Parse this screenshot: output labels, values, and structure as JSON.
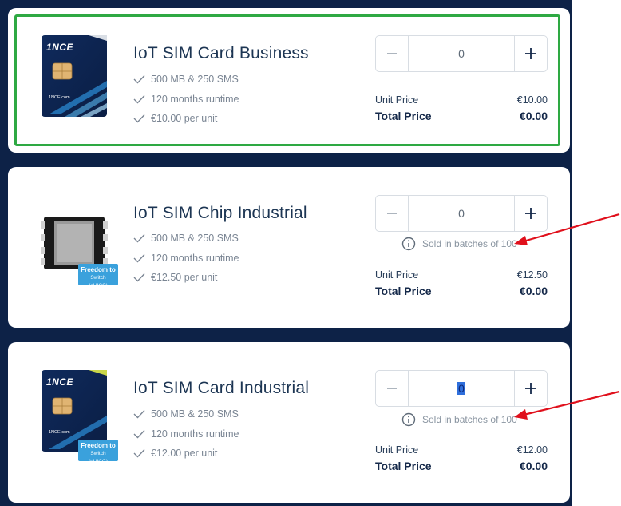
{
  "products": [
    {
      "title": "IoT SIM Card Business",
      "features": [
        "500 MB & 250 SMS",
        "120 months runtime",
        "€10.00 per unit"
      ],
      "quantity": "0",
      "batch_note": "",
      "unit_price_label": "Unit Price",
      "unit_price": "€10.00",
      "total_price_label": "Total Price",
      "total_price": "€0.00",
      "image": "sim-card-image",
      "badge": {
        "line1": "",
        "line2": ""
      }
    },
    {
      "title": "IoT SIM Chip Industrial",
      "features": [
        "500 MB & 250 SMS",
        "120 months runtime",
        "€12.50 per unit"
      ],
      "quantity": "0",
      "batch_note": "Sold in batches of 100",
      "unit_price_label": "Unit Price",
      "unit_price": "€12.50",
      "total_price_label": "Total Price",
      "total_price": "€0.00",
      "image": "sim-chip-image",
      "badge": {
        "line1": "Freedom to",
        "line2": "Switch (eUICC)"
      }
    },
    {
      "title": "IoT SIM Card Industrial",
      "features": [
        "500 MB & 250 SMS",
        "120 months runtime",
        "€12.00 per unit"
      ],
      "quantity": "0",
      "batch_note": "Sold in batches of 100",
      "unit_price_label": "Unit Price",
      "unit_price": "€12.00",
      "total_price_label": "Total Price",
      "total_price": "€0.00",
      "image": "sim-card-image",
      "badge": {
        "line1": "Freedom to",
        "line2": "Switch (eUICC)"
      }
    }
  ],
  "brand": {
    "logo_text": "1NCE",
    "url_text": "1NCE.com"
  },
  "colors": {
    "background": "#0d2247",
    "card": "#ffffff",
    "highlight": "#2ea943",
    "arrow": "#e0101c",
    "badge": "#3aa1dc",
    "title": "#1c3553"
  },
  "icons": {
    "minus": "minus-icon",
    "plus": "plus-icon",
    "check": "checkmark-icon",
    "info": "info-circle-icon",
    "arrow": "red-arrow-annotation"
  }
}
